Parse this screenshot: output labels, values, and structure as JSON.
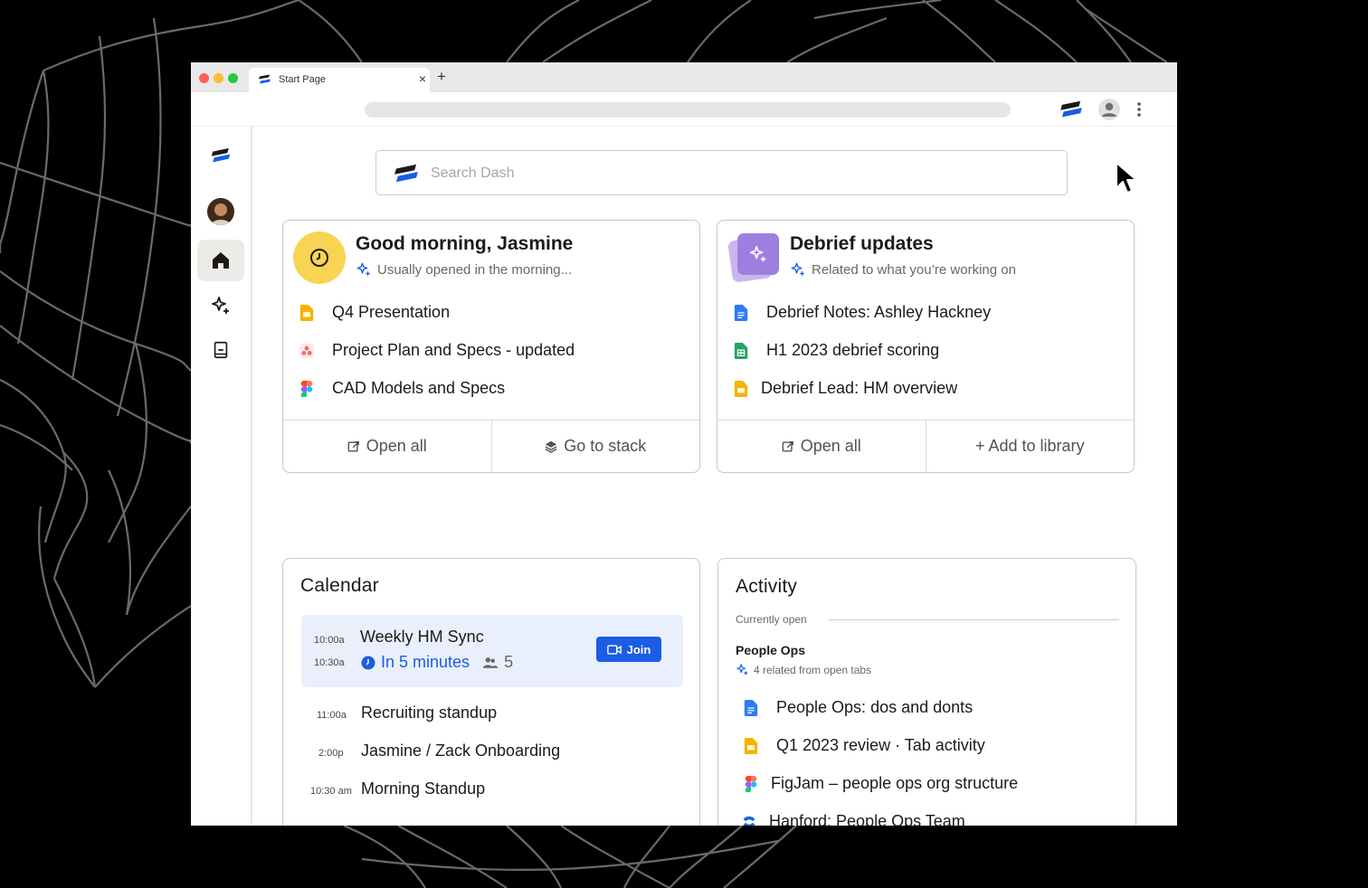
{
  "window": {
    "traffic_colors": [
      "#fe5f57",
      "#febc2e",
      "#28c840"
    ],
    "tab_title": "Start Page",
    "tab_close": "×",
    "new_tab": "+"
  },
  "search": {
    "placeholder": "Search Dash"
  },
  "sidebar": {
    "items": [
      {
        "name": "home",
        "icon": "home-icon",
        "active": true
      },
      {
        "name": "ai",
        "icon": "sparkle-icon",
        "active": false
      },
      {
        "name": "library",
        "icon": "book-icon",
        "active": false
      }
    ]
  },
  "greeting_card": {
    "title": "Good morning, Jasmine",
    "subtitle": "Usually opened in the morning...",
    "items": [
      {
        "label": "Q4 Presentation",
        "icon": "google-slides-icon"
      },
      {
        "label": "Project Plan and Specs - updated",
        "icon": "asana-icon"
      },
      {
        "label": "CAD Models and Specs",
        "icon": "figma-icon"
      }
    ],
    "actions": {
      "open_all": "Open all",
      "go_to_stack": "Go to stack"
    }
  },
  "debrief_card": {
    "title": "Debrief updates",
    "subtitle": "Related to what you’re working on",
    "items": [
      {
        "label": "Debrief Notes: Ashley Hackney",
        "icon": "google-docs-icon"
      },
      {
        "label": "H1 2023 debrief scoring",
        "icon": "google-sheets-icon"
      },
      {
        "label": "Debrief Lead: HM overview",
        "icon": "google-slides-icon"
      }
    ],
    "actions": {
      "open_all": "Open all",
      "add_to_library": "+ Add to library"
    }
  },
  "calendar": {
    "title": "Calendar",
    "highlight": {
      "start": "10:00a",
      "end": "10:30a",
      "title": "Weekly HM Sync",
      "status": "In 5 minutes",
      "attendees": "5",
      "join_label": "Join"
    },
    "events": [
      {
        "time": "11:00a",
        "title": "Recruiting standup"
      },
      {
        "time": "2:00p",
        "title": "Jasmine / Zack Onboarding"
      },
      {
        "time": "10:30 am",
        "title": "Morning Standup"
      }
    ]
  },
  "activity": {
    "title": "Activity",
    "currently_open": "Currently open",
    "group_title": "People Ops",
    "group_sub": "4 related from open tabs",
    "items": [
      {
        "label": "People Ops: dos and donts",
        "icon": "google-docs-icon"
      },
      {
        "label": "Q1 2023 review · Tab activity",
        "icon": "google-slides-icon"
      },
      {
        "label": "FigJam – people ops org structure",
        "icon": "figma-icon"
      },
      {
        "label": "Hanford: People Ops Team",
        "icon": "confluence-icon"
      }
    ]
  },
  "colors": {
    "accent": "#1a5ce6",
    "greeting_badge": "#f7d553",
    "debrief_badge": "#9e7fe0"
  }
}
